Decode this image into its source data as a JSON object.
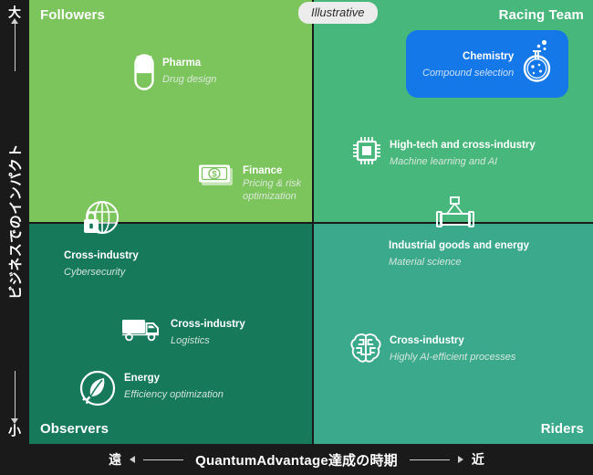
{
  "badge": {
    "label": "Illustrative"
  },
  "colors": {
    "quadrant_top_left": "#7cc45c",
    "quadrant_top_right": "#48b77b",
    "quadrant_bottom_left": "#15795a",
    "quadrant_bottom_right": "#3aa98c",
    "highlight": "#1478e8",
    "background": "#1a1a1a",
    "axis_line": "#cfcfcf"
  },
  "axes": {
    "vertical": {
      "label": "ビジネスでのインパクト",
      "high_end": "大",
      "low_end": "小"
    },
    "horizontal": {
      "label": "QuantumAdvantage達成の時期",
      "left_end": "遠",
      "right_end": "近"
    }
  },
  "quadrants": {
    "top_left": {
      "label": "Followers"
    },
    "top_right": {
      "label": "Racing Team"
    },
    "bottom_left": {
      "label": "Observers"
    },
    "bottom_right": {
      "label": "Riders"
    }
  },
  "items": {
    "pharma": {
      "name": "Pharma",
      "sub": "Drug design",
      "icon": "pill-icon"
    },
    "finance": {
      "name": "Finance",
      "sub": "Pricing & risk optimization",
      "icon": "banknote-icon"
    },
    "chemistry": {
      "name": "Chemistry",
      "sub": "Compound selection",
      "icon": "flask-icon"
    },
    "hightech": {
      "name": "High-tech and cross-industry",
      "sub": "Machine learning and AI",
      "icon": "microchip-icon"
    },
    "industrial": {
      "name": "Industrial goods and energy",
      "sub": "Material science",
      "icon": "pipe-crane-icon"
    },
    "cyber": {
      "name": "Cross-industry",
      "sub": "Cybersecurity",
      "icon": "globe-lock-icon"
    },
    "logistics": {
      "name": "Cross-industry",
      "sub": "Logistics",
      "icon": "truck-icon"
    },
    "energy": {
      "name": "Energy",
      "sub": "Efficiency optimization",
      "icon": "leaf-plug-icon"
    },
    "aiprocess": {
      "name": "Cross-industry",
      "sub": "Highly AI-efficient processes",
      "icon": "brain-icon"
    }
  }
}
